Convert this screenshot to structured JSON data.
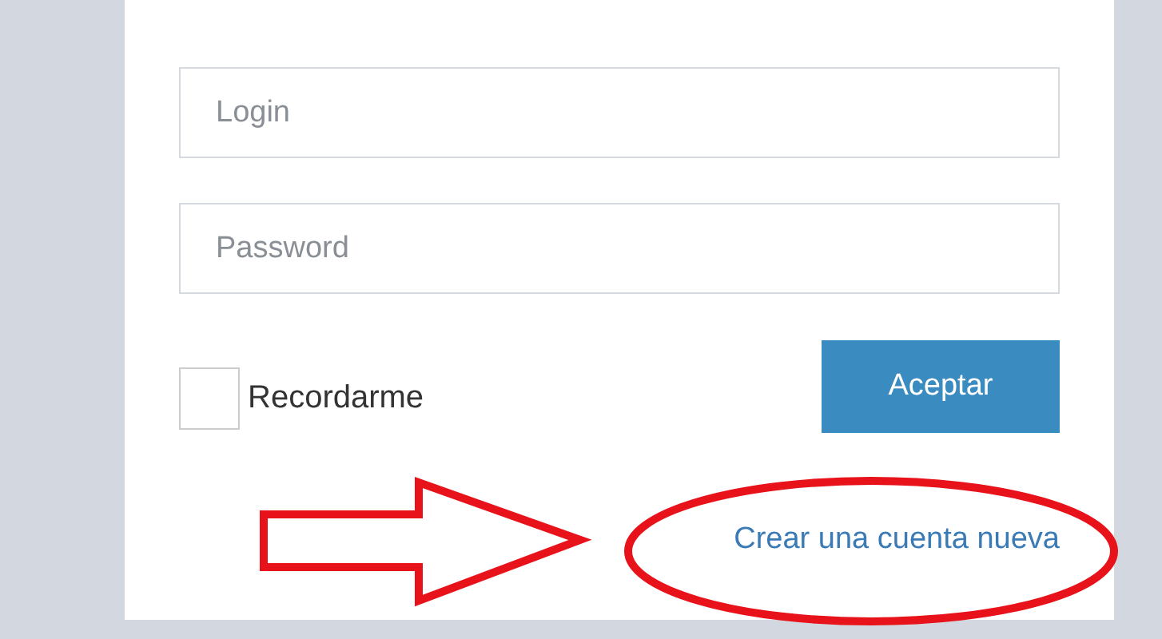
{
  "form": {
    "login": {
      "placeholder": "Login"
    },
    "password": {
      "placeholder": "Password"
    },
    "remember": {
      "label": "Recordarme",
      "checked": false
    },
    "submit": "Aceptar",
    "create_account_link": "Crear una cuenta nueva"
  }
}
